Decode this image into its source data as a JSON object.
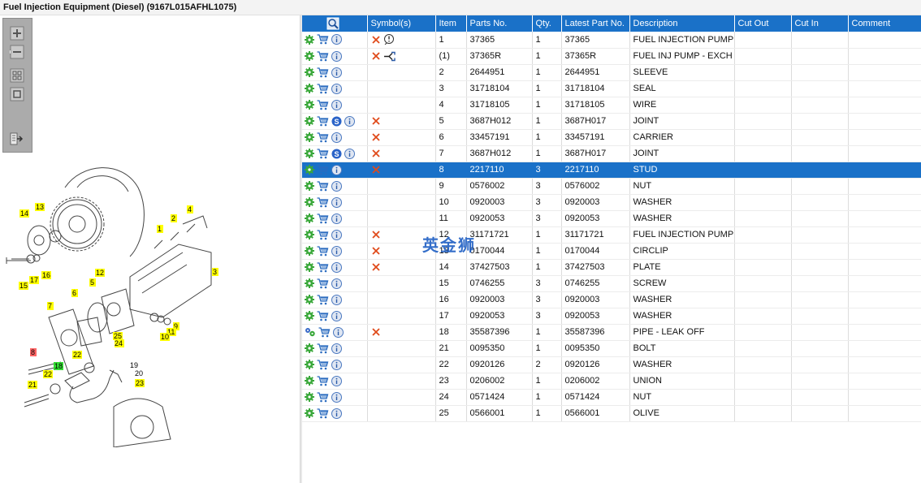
{
  "window": {
    "title": "Fuel Injection Equipment (Diesel) (9167L015AFHL1075)"
  },
  "toolbar": {
    "buttons": [
      {
        "name": "zoom-in-button",
        "icon": "zoom-in-icon"
      },
      {
        "name": "zoom-out-button",
        "icon": "zoom-out-icon"
      },
      {
        "name": "fit-all-button",
        "icon": "fit-all-icon"
      },
      {
        "name": "fit-window-button",
        "icon": "fit-window-icon"
      },
      {
        "name": "export-button",
        "icon": "export-icon"
      }
    ]
  },
  "diagram": {
    "callouts": [
      {
        "label": "14",
        "color": "#ffff00"
      },
      {
        "label": "13",
        "color": "#ffff00"
      },
      {
        "label": "2",
        "color": "#ffff00"
      },
      {
        "label": "4",
        "color": "#ffff00"
      },
      {
        "label": "1",
        "color": "#ffff00"
      },
      {
        "label": "3",
        "color": "#ffff00"
      },
      {
        "label": "12",
        "color": "#ffff00"
      },
      {
        "label": "15",
        "color": "#ffff00"
      },
      {
        "label": "17",
        "color": "#ffff00"
      },
      {
        "label": "16",
        "color": "#ffff00"
      },
      {
        "label": "5",
        "color": "#ffff00"
      },
      {
        "label": "6",
        "color": "#ffff00"
      },
      {
        "label": "7",
        "color": "#ffff00"
      },
      {
        "label": "9",
        "color": "#ffff00"
      },
      {
        "label": "11",
        "color": "#ffff00"
      },
      {
        "label": "10",
        "color": "#ffff00"
      },
      {
        "label": "25",
        "color": "#ffff00"
      },
      {
        "label": "24",
        "color": "#ffff00"
      },
      {
        "label": "8",
        "color": "#ff6666"
      },
      {
        "label": "22",
        "color": "#ffff00"
      },
      {
        "label": "18",
        "color": "#33dd33"
      },
      {
        "label": "22",
        "color": "#ffff00"
      },
      {
        "label": "19",
        "color": "none"
      },
      {
        "label": "20",
        "color": "none"
      },
      {
        "label": "21",
        "color": "#ffff00"
      },
      {
        "label": "23",
        "color": "#ffff00"
      }
    ]
  },
  "table": {
    "headers": [
      "",
      "Symbol(s)",
      "Item",
      "Parts No.",
      "Qty.",
      "Latest Part No.",
      "Description",
      "Cut Out",
      "Cut In",
      "Comment"
    ],
    "selected_item": "8",
    "rows": [
      {
        "item": "1",
        "part": "37365",
        "qty": "1",
        "latest": "37365",
        "desc": "FUEL INJECTION PUMP",
        "s_icon": false,
        "symbols": [
          "x",
          "warning"
        ],
        "gear": "gear"
      },
      {
        "item": "(1)",
        "part": "37365R",
        "qty": "1",
        "latest": "37365R",
        "desc": "FUEL INJ PUMP - EXCH",
        "s_icon": false,
        "symbols": [
          "x",
          "exchange"
        ],
        "gear": "gear"
      },
      {
        "item": "2",
        "part": "2644951",
        "qty": "1",
        "latest": "2644951",
        "desc": "SLEEVE",
        "s_icon": false,
        "symbols": [],
        "gear": "gear"
      },
      {
        "item": "3",
        "part": "31718104",
        "qty": "1",
        "latest": "31718104",
        "desc": "SEAL",
        "s_icon": false,
        "symbols": [],
        "gear": "gear"
      },
      {
        "item": "4",
        "part": "31718105",
        "qty": "1",
        "latest": "31718105",
        "desc": "WIRE",
        "s_icon": false,
        "symbols": [],
        "gear": "gear"
      },
      {
        "item": "5",
        "part": "3687H012",
        "qty": "1",
        "latest": "3687H017",
        "desc": "JOINT",
        "s_icon": true,
        "symbols": [
          "x"
        ],
        "gear": "gear"
      },
      {
        "item": "6",
        "part": "33457191",
        "qty": "1",
        "latest": "33457191",
        "desc": "CARRIER",
        "s_icon": false,
        "symbols": [
          "x"
        ],
        "gear": "gear"
      },
      {
        "item": "7",
        "part": "3687H012",
        "qty": "1",
        "latest": "3687H017",
        "desc": "JOINT",
        "s_icon": true,
        "symbols": [
          "x"
        ],
        "gear": "gear"
      },
      {
        "item": "8",
        "part": "2217110",
        "qty": "3",
        "latest": "2217110",
        "desc": "STUD",
        "s_icon": false,
        "symbols": [
          "x"
        ],
        "gear": "gear"
      },
      {
        "item": "9",
        "part": "0576002",
        "qty": "3",
        "latest": "0576002",
        "desc": "NUT",
        "s_icon": false,
        "symbols": [],
        "gear": "gear"
      },
      {
        "item": "10",
        "part": "0920003",
        "qty": "3",
        "latest": "0920003",
        "desc": "WASHER",
        "s_icon": false,
        "symbols": [],
        "gear": "gear"
      },
      {
        "item": "11",
        "part": "0920053",
        "qty": "3",
        "latest": "0920053",
        "desc": "WASHER",
        "s_icon": false,
        "symbols": [],
        "gear": "gear"
      },
      {
        "item": "12",
        "part": "31171721",
        "qty": "1",
        "latest": "31171721",
        "desc": "FUEL INJECTION PUMP G",
        "s_icon": false,
        "symbols": [
          "x"
        ],
        "gear": "gear"
      },
      {
        "item": "13",
        "part": "0170044",
        "qty": "1",
        "latest": "0170044",
        "desc": "CIRCLIP",
        "s_icon": false,
        "symbols": [
          "x"
        ],
        "gear": "gear"
      },
      {
        "item": "14",
        "part": "37427503",
        "qty": "1",
        "latest": "37427503",
        "desc": "PLATE",
        "s_icon": false,
        "symbols": [
          "x"
        ],
        "gear": "gear"
      },
      {
        "item": "15",
        "part": "0746255",
        "qty": "3",
        "latest": "0746255",
        "desc": "SCREW",
        "s_icon": false,
        "symbols": [],
        "gear": "gear"
      },
      {
        "item": "16",
        "part": "0920003",
        "qty": "3",
        "latest": "0920003",
        "desc": "WASHER",
        "s_icon": false,
        "symbols": [],
        "gear": "gear"
      },
      {
        "item": "17",
        "part": "0920053",
        "qty": "3",
        "latest": "0920053",
        "desc": "WASHER",
        "s_icon": false,
        "symbols": [],
        "gear": "gear"
      },
      {
        "item": "18",
        "part": "35587396",
        "qty": "1",
        "latest": "35587396",
        "desc": "PIPE - LEAK OFF",
        "s_icon": false,
        "symbols": [
          "x"
        ],
        "gear": "gears"
      },
      {
        "item": "21",
        "part": "0095350",
        "qty": "1",
        "latest": "0095350",
        "desc": "BOLT",
        "s_icon": false,
        "symbols": [],
        "gear": "gear"
      },
      {
        "item": "22",
        "part": "0920126",
        "qty": "2",
        "latest": "0920126",
        "desc": "WASHER",
        "s_icon": false,
        "symbols": [],
        "gear": "gear"
      },
      {
        "item": "23",
        "part": "0206002",
        "qty": "1",
        "latest": "0206002",
        "desc": "UNION",
        "s_icon": false,
        "symbols": [],
        "gear": "gear"
      },
      {
        "item": "24",
        "part": "0571424",
        "qty": "1",
        "latest": "0571424",
        "desc": "NUT",
        "s_icon": false,
        "symbols": [],
        "gear": "gear"
      },
      {
        "item": "25",
        "part": "0566001",
        "qty": "1",
        "latest": "0566001",
        "desc": "OLIVE",
        "s_icon": false,
        "symbols": [],
        "gear": "gear"
      }
    ]
  },
  "watermark": {
    "text": "英金狮"
  },
  "colors": {
    "header": "#1a71c8",
    "selected": "#1a71c8",
    "gear": "#3aa83a",
    "cart": "#2a6bbf",
    "x": "#e04a1a"
  }
}
